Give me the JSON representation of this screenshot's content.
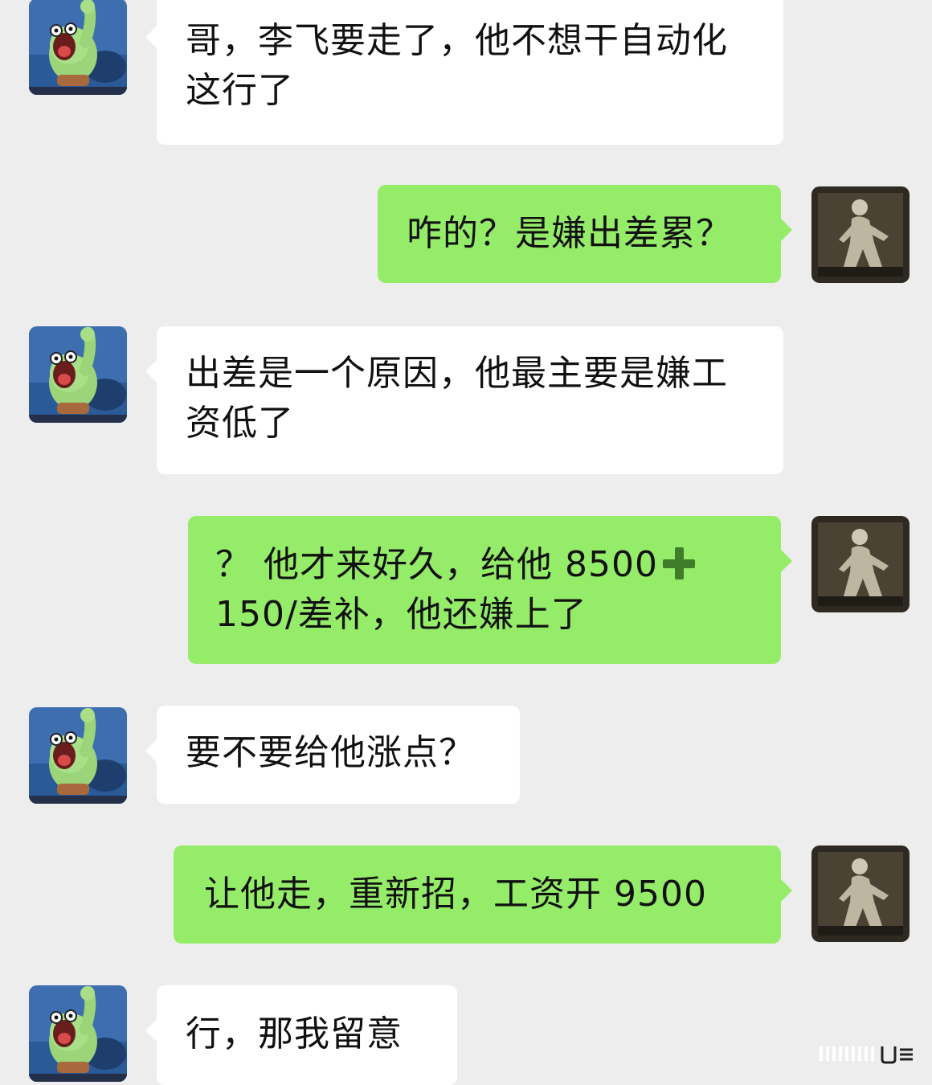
{
  "messages": [
    {
      "side": "in",
      "text": "哥，李飞要走了，他不想干自动化这行了"
    },
    {
      "side": "out",
      "text": "咋的？是嫌出差累？"
    },
    {
      "side": "in",
      "text": "出差是一个原因，他最主要是嫌工资低了"
    },
    {
      "side": "out",
      "text_a": "？ 他才来好久，给他 8500",
      "text_b": "150/差补，他还嫌上了",
      "icon": "plus-icon"
    },
    {
      "side": "in",
      "text": "要不要给他涨点？"
    },
    {
      "side": "out",
      "text": "让他走，重新招，工资开 9500"
    },
    {
      "side": "in",
      "text": "行，那我留意"
    }
  ],
  "avatars": {
    "incoming": "green-cartoon-avatar",
    "outgoing": "dark-figure-avatar"
  },
  "colors": {
    "background": "#ededed",
    "incoming_bubble": "#ffffff",
    "outgoing_bubble": "#95ec69",
    "text": "#111111"
  }
}
